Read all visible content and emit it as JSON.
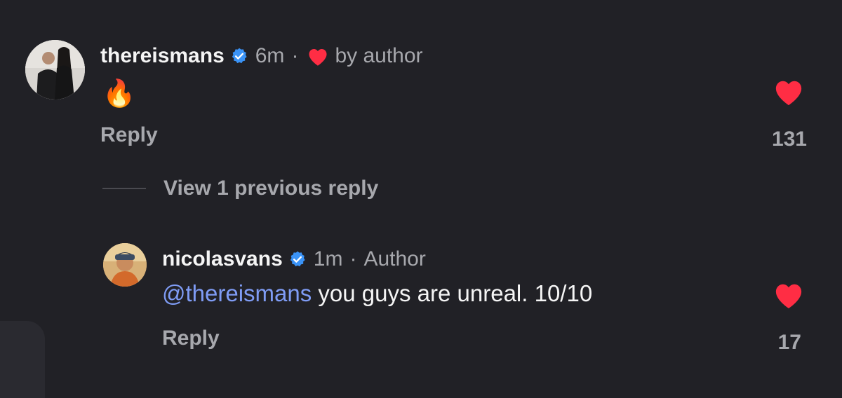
{
  "colors": {
    "background": "#212126",
    "like_red": "#ff2d44",
    "verified_blue": "#3a93f7",
    "mention_blue": "#7f9cf5",
    "muted_text": "#a7a8ad"
  },
  "comment": {
    "username": "thereismans",
    "verified_icon": "verified-badge-icon",
    "time": "6m",
    "dot": "·",
    "liked_by_icon": "heart-icon",
    "liked_by_text": "by author",
    "body_emoji": "🔥",
    "reply_label": "Reply",
    "like_count": "131"
  },
  "view_replies": {
    "label": "View 1 previous reply"
  },
  "reply": {
    "username": "nicolasvans",
    "verified_icon": "verified-badge-icon",
    "time": "1m",
    "dot": "·",
    "author_tag": "Author",
    "mention": "@thereismans",
    "body_text": " you guys are unreal. 10/10",
    "reply_label": "Reply",
    "like_count": "17"
  }
}
